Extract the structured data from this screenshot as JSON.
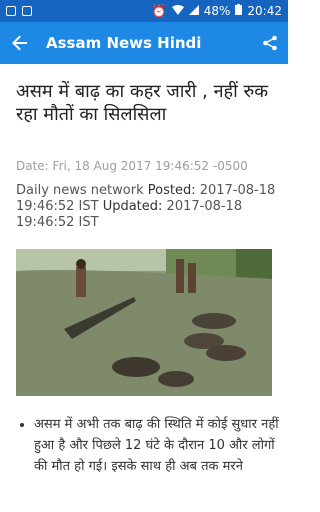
{
  "status_bar": {
    "battery_text": "48%",
    "time": "20:42"
  },
  "app_bar": {
    "title": "Assam News Hindi"
  },
  "article": {
    "headline": "असम में बाढ़ का कहर जारी , नहीं रुक रहा मौतों का सिलसिला",
    "date_line": "Date: Fri, 18 Aug 2017 19:46:52 -0500",
    "byline_prefix": "Daily news network",
    "posted_label": "Posted:",
    "posted_value": "2017-08-18 19:46:52 IST",
    "updated_label": "Updated:",
    "updated_value": "2017-08-18 19:46:52 IST",
    "bullet_1": "असम में अभी तक बाढ़ की स्थिति में कोई सुधार नहीं हुआ है और पिछले 12 घंटे के दौरान 10 और लोगों की मौत हो गई। इसके साथ ही अब तक मरने"
  }
}
